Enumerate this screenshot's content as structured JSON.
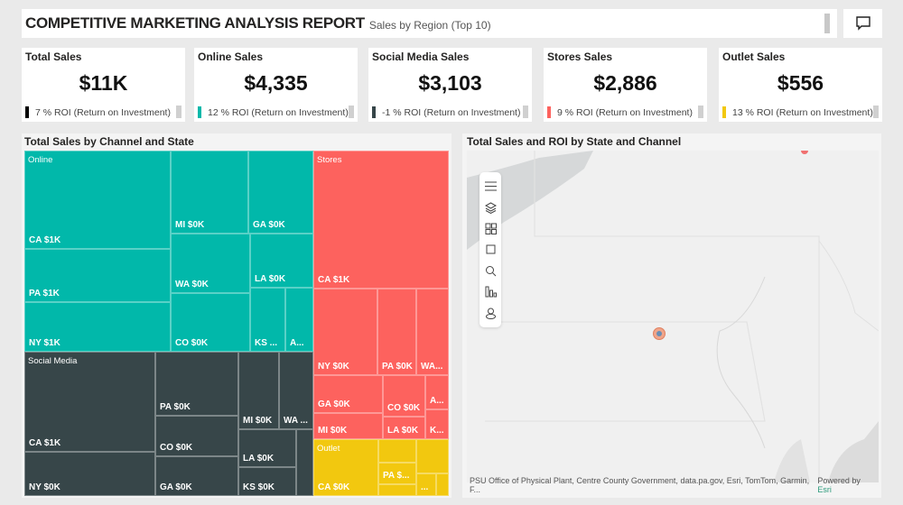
{
  "header": {
    "title": "COMPETITIVE MARKETING ANALYSIS REPORT",
    "subtitle": "Sales by Region (Top 10)"
  },
  "comment_icon": "comment-icon",
  "kpis": [
    {
      "label": "Total Sales",
      "value": "$11K",
      "roi": "7 % ROI (Return on Investment)",
      "color": "#000000"
    },
    {
      "label": "Online Sales",
      "value": "$4,335",
      "roi": "12 % ROI (Return on Investment)",
      "color": "#01B8AA"
    },
    {
      "label": "Social Media Sales",
      "value": "$3,103",
      "roi": "-1 % ROI (Return on Investment)",
      "color": "#374649"
    },
    {
      "label": "Stores Sales",
      "value": "$2,886",
      "roi": "9 % ROI (Return on Investment)",
      "color": "#FD625E"
    },
    {
      "label": "Outlet Sales",
      "value": "$556",
      "roi": "13 % ROI (Return on Investment)",
      "color": "#F2C80F"
    }
  ],
  "treemap": {
    "title": "Total Sales by Channel and State",
    "groups": {
      "online": "Online",
      "social": "Social Media",
      "stores": "Stores",
      "outlet": "Outlet"
    },
    "colors": {
      "online": "#01B8AA",
      "social": "#374649",
      "stores": "#FD625E",
      "outlet": "#F2C80F"
    },
    "cells": {
      "on_ca": "CA $1K",
      "on_pa": "PA $1K",
      "on_ny": "NY $1K",
      "on_mi": "MI $0K",
      "on_ga": "GA $0K",
      "on_wa": "WA $0K",
      "on_co": "CO $0K",
      "on_la": "LA $0K",
      "on_ks": "KS ...",
      "on_a": "A...",
      "sm_ca": "CA $1K",
      "sm_ny": "NY $0K",
      "sm_pa": "PA $0K",
      "sm_co": "CO $0K",
      "sm_ga": "GA $0K",
      "sm_mi": "MI $0K",
      "sm_wa": "WA ...",
      "sm_la": "LA $0K",
      "sm_ks": "KS $0K",
      "st_ca": "CA $1K",
      "st_ny": "NY $0K",
      "st_pa": "PA $0K",
      "st_wa": "WA...",
      "st_ga": "GA $0K",
      "st_mi": "MI $0K",
      "st_co": "CO $0K",
      "st_la": "LA $0K",
      "st_a": "A...",
      "st_k": "K...",
      "ou_ca": "CA $0K",
      "ou_pa": "PA $...",
      "ou_more": "..."
    }
  },
  "map": {
    "title": "Total Sales and ROI by State and Channel",
    "tools": [
      "menu-icon",
      "layers-icon",
      "legend-icon",
      "select-icon",
      "search-icon",
      "chart-icon",
      "person-icon"
    ],
    "attribution": "PSU Office of Physical Plant, Centre County Government, data.pa.gov, Esri, TomTom, Garmin, F...",
    "powered_by": "Powered by",
    "esri": "Esri"
  }
}
